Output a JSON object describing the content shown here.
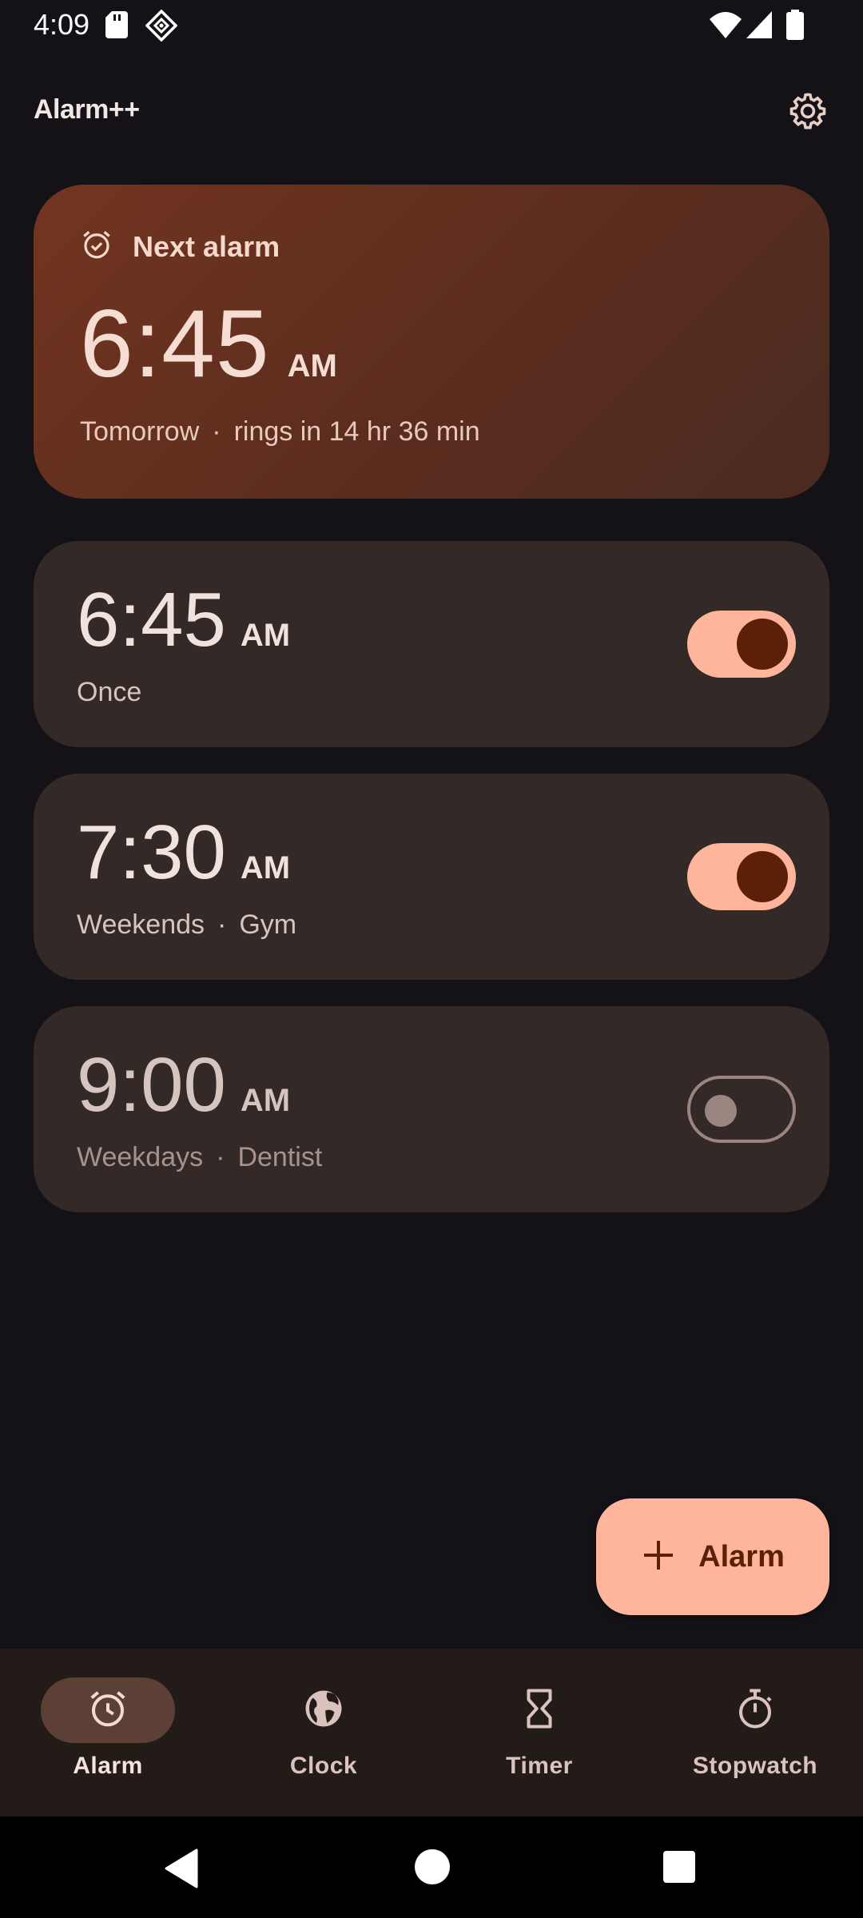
{
  "status_bar": {
    "time": "4:09",
    "left_icons": [
      "sd-card-icon",
      "diamond-app-icon"
    ],
    "right_icons": [
      "wifi-icon",
      "signal-icon",
      "battery-icon"
    ]
  },
  "app_bar": {
    "title": "Alarm++",
    "settings_icon": "gear-icon"
  },
  "next_alarm": {
    "label": "Next alarm",
    "icon": "alarm-check-icon",
    "time": "6:45",
    "ampm": "AM",
    "day": "Tomorrow",
    "separator": "·",
    "rings_in": "rings in 14 hr 36 min"
  },
  "alarms": [
    {
      "time": "6:45",
      "ampm": "AM",
      "repeat": "Once",
      "label": "",
      "enabled": true
    },
    {
      "time": "7:30",
      "ampm": "AM",
      "repeat": "Weekends",
      "separator": "·",
      "label": "Gym",
      "enabled": true
    },
    {
      "time": "9:00",
      "ampm": "AM",
      "repeat": "Weekdays",
      "separator": "·",
      "label": "Dentist",
      "enabled": false
    }
  ],
  "fab": {
    "icon": "plus-icon",
    "label": "Alarm"
  },
  "bottom_nav": {
    "items": [
      {
        "label": "Alarm",
        "icon": "alarm-clock-icon",
        "active": true
      },
      {
        "label": "Clock",
        "icon": "globe-icon",
        "active": false
      },
      {
        "label": "Timer",
        "icon": "hourglass-icon",
        "active": false
      },
      {
        "label": "Stopwatch",
        "icon": "stopwatch-icon",
        "active": false
      }
    ]
  },
  "system_nav": [
    "back-icon",
    "home-icon",
    "recents-icon"
  ],
  "colors": {
    "background": "#141217",
    "card": "#332926",
    "accent": "#ffb59c",
    "accent_dark": "#5c1f08",
    "next_card_start": "#733520",
    "next_card_end": "#4a2a20"
  }
}
